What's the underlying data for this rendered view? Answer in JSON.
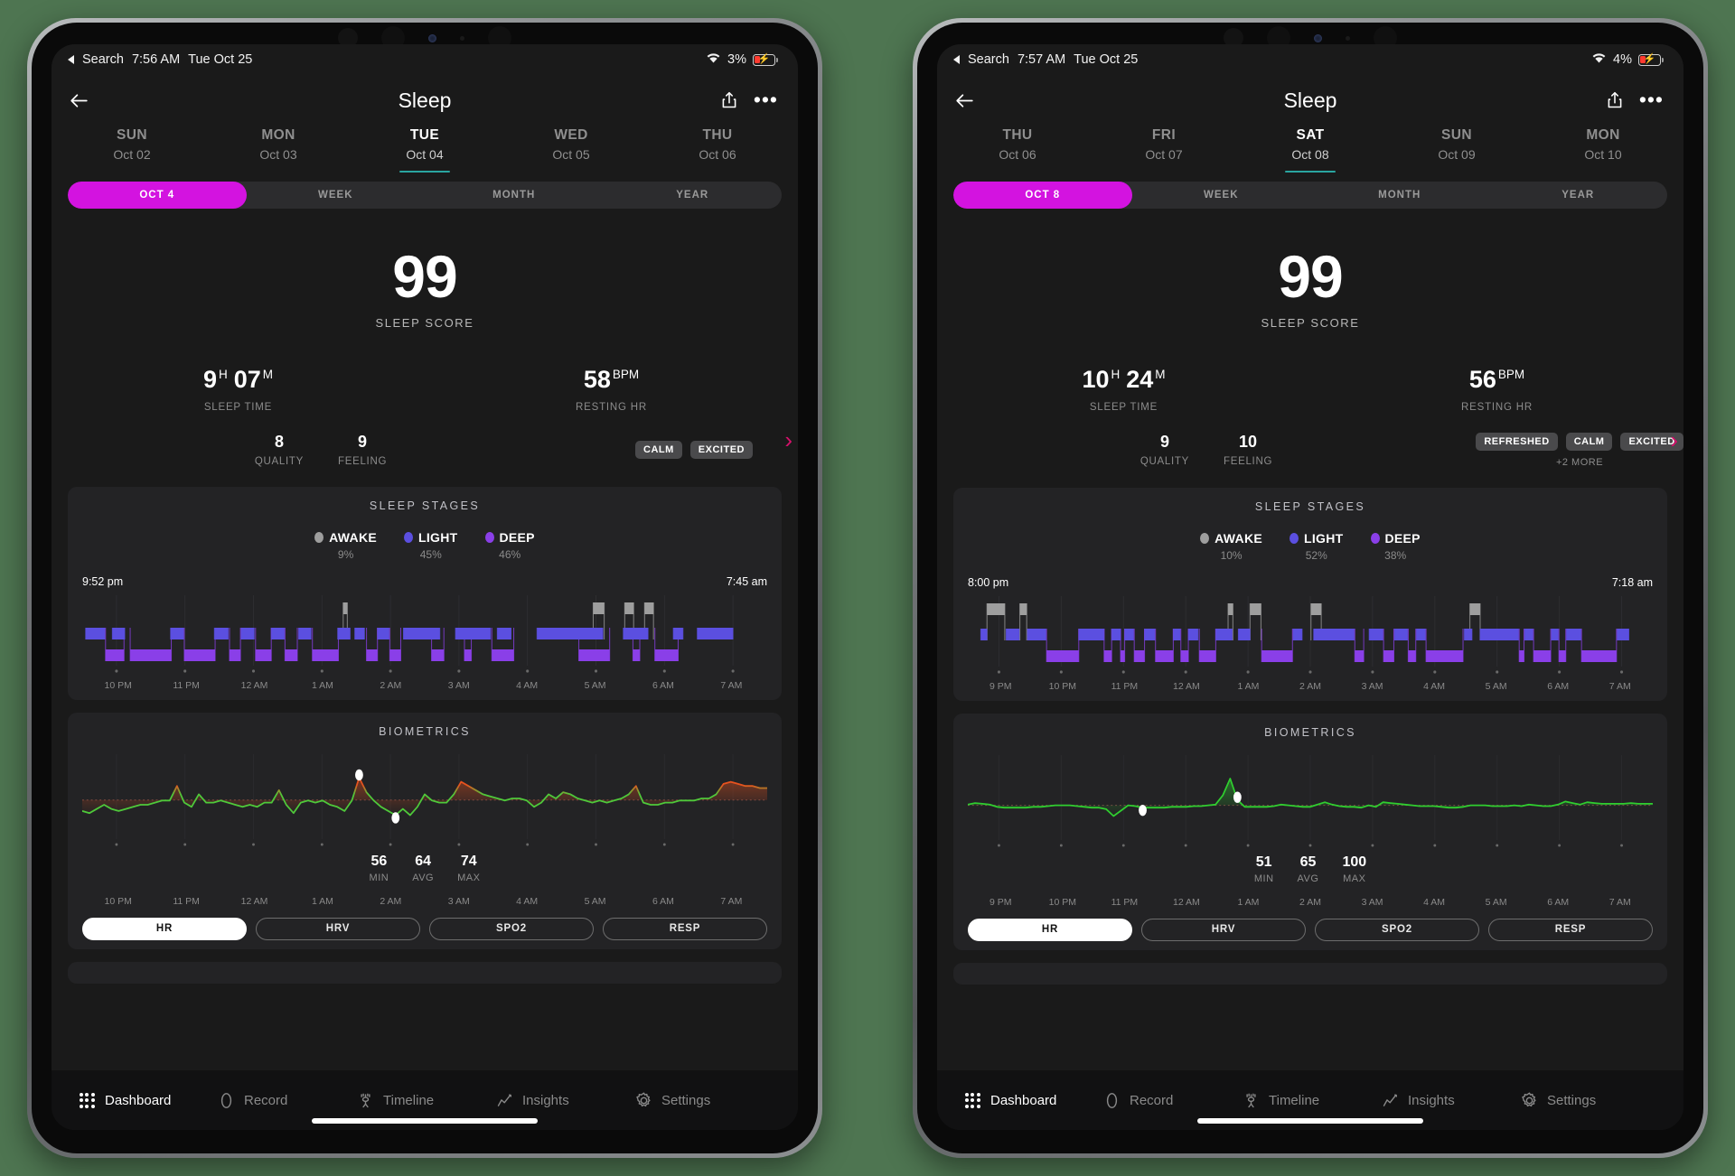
{
  "background_color": "#4e7551",
  "accent_magenta": "#d313e0",
  "accent_teal": "#2aa5a0",
  "accent_pink": "#d5116b",
  "tablets": [
    {
      "status": {
        "back_label": "Search",
        "time": "7:56 AM",
        "date": "Tue Oct 25",
        "wifi_icon": "wifi-icon",
        "battery_text": "3%",
        "battery_icon": "battery-charging-icon"
      },
      "nav": {
        "back_icon": "arrow-left-icon",
        "title": "Sleep",
        "share_icon": "share-icon",
        "more_icon": "more-icon"
      },
      "days": [
        {
          "dow": "SUN",
          "date": "Oct 02",
          "active": false
        },
        {
          "dow": "MON",
          "date": "Oct 03",
          "active": false
        },
        {
          "dow": "TUE",
          "date": "Oct 04",
          "active": true
        },
        {
          "dow": "WED",
          "date": "Oct 05",
          "active": false
        },
        {
          "dow": "THU",
          "date": "Oct 06",
          "active": false
        }
      ],
      "segments": [
        {
          "label": "OCT 4",
          "active": true
        },
        {
          "label": "WEEK",
          "active": false
        },
        {
          "label": "MONTH",
          "active": false
        },
        {
          "label": "YEAR",
          "active": false
        }
      ],
      "score": {
        "value": "99",
        "label": "SLEEP SCORE"
      },
      "stats": [
        {
          "value": "9",
          "unit": "H",
          "value2": "07",
          "unit2": "M",
          "caption": "SLEEP TIME"
        },
        {
          "value": "58",
          "unit": "BPM",
          "caption": "RESTING HR"
        }
      ],
      "ratings": [
        {
          "value": "8",
          "caption": "QUALITY"
        },
        {
          "value": "9",
          "caption": "FEELING"
        }
      ],
      "tags": [
        "CALM",
        "EXCITED"
      ],
      "tags_more": "",
      "sleep_stages": {
        "title": "SLEEP STAGES",
        "legend": [
          {
            "name": "AWAKE",
            "pct": "9%",
            "color": "#9e9e9e"
          },
          {
            "name": "LIGHT",
            "pct": "45%",
            "color": "#5b4fe0"
          },
          {
            "name": "DEEP",
            "pct": "46%",
            "color": "#8a3fe8"
          }
        ],
        "start_time": "9:52 pm",
        "end_time": "7:45 am",
        "ticks": [
          "10 PM",
          "11 PM",
          "12 AM",
          "1 AM",
          "2 AM",
          "3 AM",
          "4 AM",
          "5 AM",
          "6 AM",
          "7 AM"
        ],
        "awake_segments": [
          [
            38.1,
            38.7
          ],
          [
            74.6,
            76.2
          ],
          [
            79.2,
            80.5
          ],
          [
            82.1,
            83.4
          ]
        ],
        "light_segments": [
          [
            0.5,
            3.3
          ],
          [
            4.4,
            6.2
          ],
          [
            12.9,
            14.8
          ],
          [
            19.3,
            21.3
          ],
          [
            23.2,
            25.1
          ],
          [
            27.6,
            29.5
          ],
          [
            31.6,
            33.4
          ],
          [
            37.3,
            39.1
          ],
          [
            39.8,
            41.2
          ],
          [
            43.1,
            44.8
          ],
          [
            46.9,
            52.2
          ],
          [
            54.5,
            59.6
          ],
          [
            60.6,
            62.6
          ],
          [
            66.4,
            76.0
          ],
          [
            79.0,
            82.6
          ],
          [
            86.3,
            87.7
          ],
          [
            89.8,
            95.0
          ]
        ],
        "deep_segments": [
          [
            3.4,
            6.1
          ],
          [
            7.0,
            13.0
          ],
          [
            14.9,
            19.4
          ],
          [
            21.5,
            23.1
          ],
          [
            25.3,
            27.6
          ],
          [
            29.6,
            31.4
          ],
          [
            33.6,
            37.4
          ],
          [
            41.5,
            43.1
          ],
          [
            44.9,
            46.5
          ],
          [
            51.0,
            52.8
          ],
          [
            55.8,
            56.8
          ],
          [
            59.8,
            63.0
          ],
          [
            72.5,
            77.0
          ],
          [
            80.4,
            81.4
          ],
          [
            83.6,
            87.0
          ]
        ]
      },
      "biometrics": {
        "title": "BIOMETRICS",
        "stats": [
          {
            "value": "56",
            "caption": "MIN"
          },
          {
            "value": "64",
            "caption": "AVG"
          },
          {
            "value": "74",
            "caption": "MAX"
          }
        ],
        "ticks": [
          "10 PM",
          "11 PM",
          "12 AM",
          "1 AM",
          "2 AM",
          "3 AM",
          "4 AM",
          "5 AM",
          "6 AM",
          "7 AM"
        ],
        "line_color_low": "#4ec93a",
        "line_color_high": "#e8521e",
        "max_marker_x": 40.5,
        "min_marker_x": 45.8,
        "series": [
          58,
          57,
          59,
          61,
          59,
          58,
          59,
          60,
          61,
          61,
          62,
          63,
          63,
          70,
          62,
          60,
          66,
          62,
          62,
          63,
          62,
          61,
          60,
          61,
          60,
          62,
          62,
          68,
          61,
          57,
          62,
          63,
          62,
          63,
          61,
          60,
          58,
          63,
          74,
          67,
          63,
          60,
          58,
          56,
          59,
          56,
          60,
          66,
          63,
          62,
          62,
          66,
          72,
          70,
          68,
          66,
          65,
          64,
          63,
          64,
          64,
          63,
          60,
          62,
          66,
          64,
          67,
          66,
          64,
          63,
          62,
          63,
          62,
          63,
          64,
          66,
          70,
          62,
          61,
          61,
          62,
          62,
          63,
          63,
          63,
          64,
          64,
          66,
          71,
          72,
          71,
          70,
          70,
          69,
          69
        ]
      },
      "metrics": [
        {
          "label": "HR",
          "active": true
        },
        {
          "label": "HRV",
          "active": false
        },
        {
          "label": "SPO2",
          "active": false
        },
        {
          "label": "RESP",
          "active": false
        }
      ],
      "tabs": [
        {
          "label": "Dashboard",
          "icon": "grid-dots-icon",
          "active": true
        },
        {
          "label": "Record",
          "icon": "circle-icon",
          "active": false
        },
        {
          "label": "Timeline",
          "icon": "person-icon",
          "active": false
        },
        {
          "label": "Insights",
          "icon": "line-chart-icon",
          "active": false
        },
        {
          "label": "Settings",
          "icon": "gear-icon",
          "active": false
        }
      ]
    },
    {
      "status": {
        "back_label": "Search",
        "time": "7:57 AM",
        "date": "Tue Oct 25",
        "wifi_icon": "wifi-icon",
        "battery_text": "4%",
        "battery_icon": "battery-charging-icon"
      },
      "nav": {
        "back_icon": "arrow-left-icon",
        "title": "Sleep",
        "share_icon": "share-icon",
        "more_icon": "more-icon"
      },
      "days": [
        {
          "dow": "THU",
          "date": "Oct 06",
          "active": false
        },
        {
          "dow": "FRI",
          "date": "Oct 07",
          "active": false
        },
        {
          "dow": "SAT",
          "date": "Oct 08",
          "active": true
        },
        {
          "dow": "SUN",
          "date": "Oct 09",
          "active": false
        },
        {
          "dow": "MON",
          "date": "Oct 10",
          "active": false
        }
      ],
      "segments": [
        {
          "label": "OCT 8",
          "active": true
        },
        {
          "label": "WEEK",
          "active": false
        },
        {
          "label": "MONTH",
          "active": false
        },
        {
          "label": "YEAR",
          "active": false
        }
      ],
      "score": {
        "value": "99",
        "label": "SLEEP SCORE"
      },
      "stats": [
        {
          "value": "10",
          "unit": "H",
          "value2": "24",
          "unit2": "M",
          "caption": "SLEEP TIME"
        },
        {
          "value": "56",
          "unit": "BPM",
          "caption": "RESTING HR"
        }
      ],
      "ratings": [
        {
          "value": "9",
          "caption": "QUALITY"
        },
        {
          "value": "10",
          "caption": "FEELING"
        }
      ],
      "tags": [
        "REFRESHED",
        "CALM",
        "EXCITED"
      ],
      "tags_more": "+2 MORE",
      "sleep_stages": {
        "title": "SLEEP STAGES",
        "legend": [
          {
            "name": "AWAKE",
            "pct": "10%",
            "color": "#9e9e9e"
          },
          {
            "name": "LIGHT",
            "pct": "52%",
            "color": "#5b4fe0"
          },
          {
            "name": "DEEP",
            "pct": "38%",
            "color": "#8a3fe8"
          }
        ],
        "start_time": "8:00 pm",
        "end_time": "7:18 am",
        "ticks": [
          "9 PM",
          "10 PM",
          "11 PM",
          "12 AM",
          "1 AM",
          "2 AM",
          "3 AM",
          "4 AM",
          "5 AM",
          "6 AM",
          "7 AM"
        ],
        "awake_segments": [
          [
            2.8,
            5.4
          ],
          [
            7.6,
            8.6
          ],
          [
            38.0,
            38.7
          ],
          [
            41.2,
            42.8
          ],
          [
            50.1,
            51.6
          ],
          [
            73.3,
            74.8
          ]
        ],
        "light_segments": [
          [
            1.9,
            2.8
          ],
          [
            5.6,
            7.5
          ],
          [
            8.7,
            11.4
          ],
          [
            16.2,
            19.9
          ],
          [
            21.0,
            22.3
          ],
          [
            22.9,
            24.2
          ],
          [
            25.8,
            27.3
          ],
          [
            30.0,
            31.0
          ],
          [
            32.2,
            33.6
          ],
          [
            36.2,
            38.6
          ],
          [
            39.5,
            41.2
          ],
          [
            47.5,
            48.8
          ],
          [
            50.5,
            56.4
          ],
          [
            58.6,
            60.6
          ],
          [
            62.3,
            64.2
          ],
          [
            65.5,
            66.8
          ],
          [
            72.5,
            73.6
          ],
          [
            74.8,
            80.4
          ],
          [
            81.3,
            82.5
          ],
          [
            85.2,
            86.2
          ],
          [
            87.4,
            89.5
          ],
          [
            94.8,
            96.5
          ]
        ],
        "deep_segments": [
          [
            11.5,
            16.2
          ],
          [
            19.9,
            21.0
          ],
          [
            22.3,
            22.9
          ],
          [
            24.3,
            25.8
          ],
          [
            27.4,
            30.0
          ],
          [
            31.1,
            32.2
          ],
          [
            33.8,
            36.2
          ],
          [
            42.9,
            47.4
          ],
          [
            56.5,
            57.8
          ],
          [
            60.7,
            62.2
          ],
          [
            64.3,
            65.4
          ],
          [
            66.9,
            72.3
          ],
          [
            80.5,
            81.2
          ],
          [
            82.6,
            85.1
          ],
          [
            86.3,
            87.3
          ],
          [
            89.6,
            94.7
          ]
        ]
      },
      "biometrics": {
        "title": "BIOMETRICS",
        "stats": [
          {
            "value": "51",
            "caption": "MIN"
          },
          {
            "value": "65",
            "caption": "AVG"
          },
          {
            "value": "100",
            "caption": "MAX"
          }
        ],
        "ticks": [
          "9 PM",
          "10 PM",
          "11 PM",
          "12 AM",
          "1 AM",
          "2 AM",
          "3 AM",
          "4 AM",
          "5 AM",
          "6 AM",
          "7 AM"
        ],
        "line_color_low": "#2fce2f",
        "line_color_high": "#2fce2f",
        "max_marker_x": 39.2,
        "min_marker_x": 25.0,
        "series": [
          66,
          68,
          67,
          66,
          63,
          62,
          62,
          62,
          62,
          63,
          63,
          64,
          65,
          65,
          65,
          64,
          63,
          62,
          62,
          60,
          51,
          58,
          65,
          64,
          62,
          62,
          62,
          62,
          63,
          63,
          63,
          64,
          64,
          65,
          66,
          78,
          100,
          72,
          63,
          63,
          63,
          63,
          64,
          66,
          65,
          64,
          63,
          63,
          66,
          69,
          66,
          64,
          63,
          63,
          62,
          65,
          63,
          69,
          68,
          67,
          66,
          65,
          64,
          64,
          64,
          63,
          62,
          62,
          63,
          65,
          65,
          65,
          64,
          64,
          64,
          65,
          64,
          66,
          65,
          64,
          64,
          66,
          70,
          68,
          66,
          69,
          68,
          67,
          67,
          67,
          67,
          68,
          67,
          67,
          67
        ]
      },
      "metrics": [
        {
          "label": "HR",
          "active": true
        },
        {
          "label": "HRV",
          "active": false
        },
        {
          "label": "SPO2",
          "active": false
        },
        {
          "label": "RESP",
          "active": false
        }
      ],
      "tabs": [
        {
          "label": "Dashboard",
          "icon": "grid-dots-icon",
          "active": true
        },
        {
          "label": "Record",
          "icon": "circle-icon",
          "active": false
        },
        {
          "label": "Timeline",
          "icon": "person-icon",
          "active": false
        },
        {
          "label": "Insights",
          "icon": "line-chart-icon",
          "active": false
        },
        {
          "label": "Settings",
          "icon": "gear-icon",
          "active": false
        }
      ]
    }
  ]
}
